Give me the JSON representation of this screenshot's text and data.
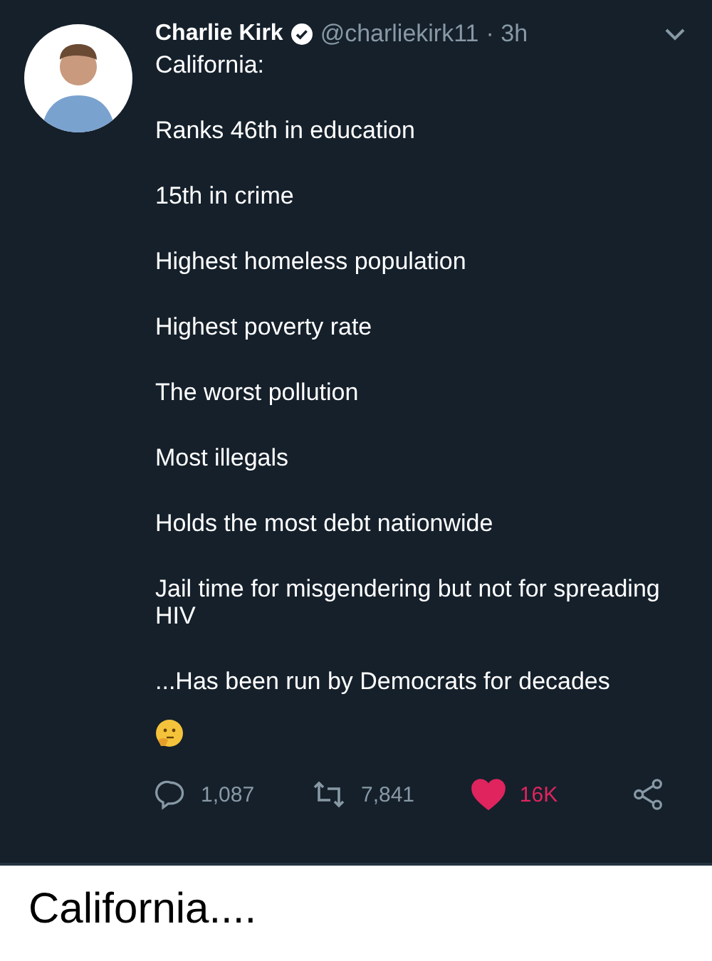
{
  "tweet": {
    "name": "Charlie Kirk",
    "verified": true,
    "handle": "@charliekirk11",
    "time": "· 3h",
    "lines": [
      "California:",
      "Ranks 46th in education",
      "15th in crime",
      "Highest homeless population",
      "Highest poverty rate",
      "The worst pollution",
      "Most illegals",
      "Holds the most debt nationwide",
      "Jail time for misgendering but not for spreading HIV",
      "...Has been run by Democrats for decades"
    ],
    "actions": [
      {
        "kind": "reply",
        "count": "1,087"
      },
      {
        "kind": "retweet",
        "count": "7,841"
      },
      {
        "kind": "like",
        "count": "16K",
        "liked": true
      },
      {
        "kind": "share"
      }
    ]
  },
  "caption": "California...."
}
